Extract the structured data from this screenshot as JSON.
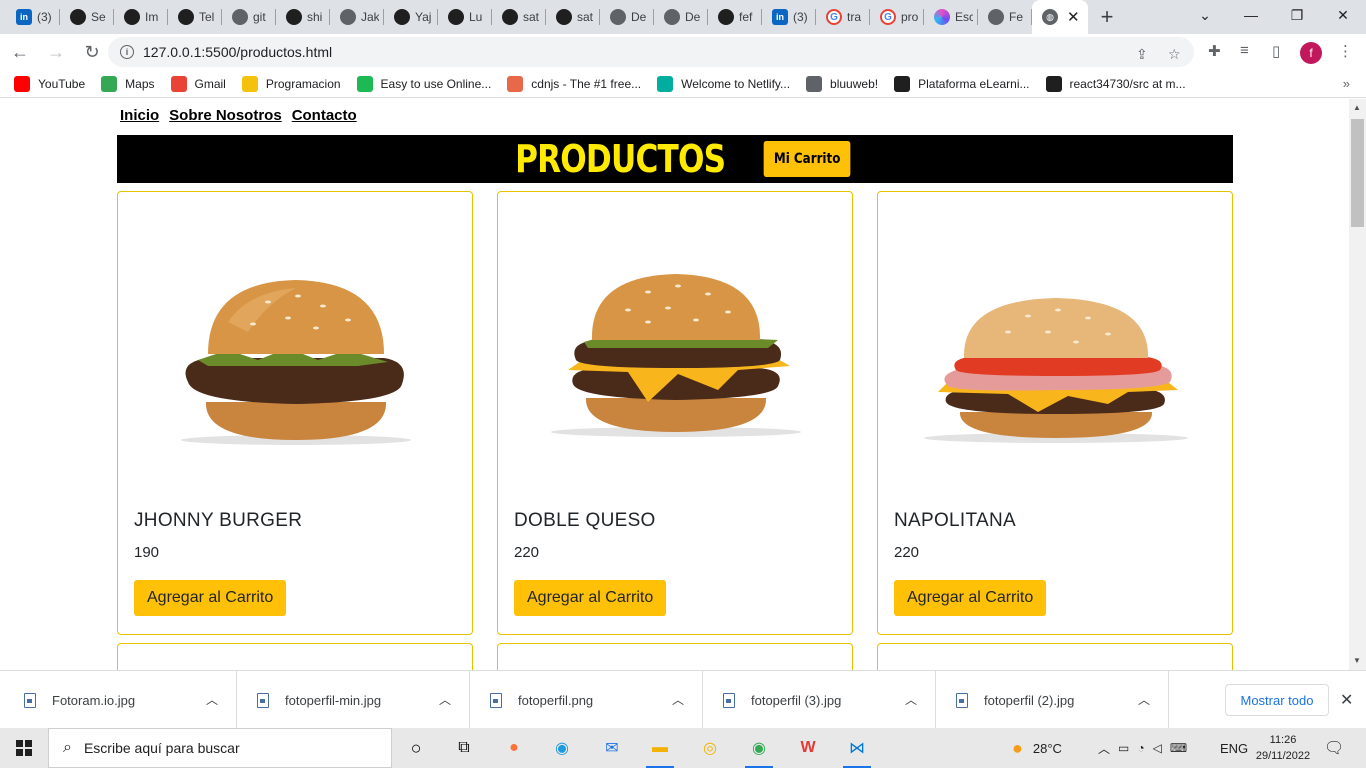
{
  "browser": {
    "tabs": [
      {
        "icon": "linkedin-icon",
        "label": "(3)"
      },
      {
        "icon": "github-icon",
        "label": "Se"
      },
      {
        "icon": "github-icon",
        "label": "Im"
      },
      {
        "icon": "github-icon",
        "label": "Tel"
      },
      {
        "icon": "globe-icon",
        "label": "git"
      },
      {
        "icon": "github-icon",
        "label": "shi"
      },
      {
        "icon": "globe-icon",
        "label": "Jak"
      },
      {
        "icon": "github-icon",
        "label": "Yaj"
      },
      {
        "icon": "github-icon",
        "label": "Lu"
      },
      {
        "icon": "github-icon",
        "label": "sat"
      },
      {
        "icon": "github-icon",
        "label": "sat"
      },
      {
        "icon": "globe-icon",
        "label": "De"
      },
      {
        "icon": "globe-icon",
        "label": "De"
      },
      {
        "icon": "github-icon",
        "label": "fef"
      },
      {
        "icon": "linkedin-icon",
        "label": "(3)"
      },
      {
        "icon": "google-icon",
        "label": "tra"
      },
      {
        "icon": "google-icon",
        "label": "pro"
      },
      {
        "icon": "ring-icon",
        "label": "Esc"
      },
      {
        "icon": "globe-icon",
        "label": "Fe"
      }
    ],
    "url": "127.0.0.1:5500/productos.html",
    "profile_initial": "f",
    "bookmarks": [
      {
        "label": "YouTube",
        "color": "#ff0000"
      },
      {
        "label": "Maps",
        "color": "#34a853"
      },
      {
        "label": "Gmail",
        "color": "#ea4335"
      },
      {
        "label": "Programacion",
        "color": "#f4c20d"
      },
      {
        "label": "Easy to use Online...",
        "color": "#1db954"
      },
      {
        "label": "cdnjs - The #1 free...",
        "color": "#e8684a"
      },
      {
        "label": "Welcome to Netlify...",
        "color": "#00ad9f"
      },
      {
        "label": "bluuweb!",
        "color": "#5f6368"
      },
      {
        "label": "Plataforma eLearni...",
        "color": "#1f1f1f"
      },
      {
        "label": "react34730/src at m...",
        "color": "#1f1f1f"
      }
    ]
  },
  "site": {
    "nav": [
      "Inicio",
      "Sobre Nosotros",
      "Contacto"
    ],
    "banner_title": "PRODUCTOS",
    "cart_button": "Mi Carrito",
    "products": [
      {
        "name": "JHONNY BURGER",
        "price": "190",
        "button": "Agregar al Carrito"
      },
      {
        "name": "DOBLE QUESO",
        "price": "220",
        "button": "Agregar al Carrito"
      },
      {
        "name": "NAPOLITANA",
        "price": "220",
        "button": "Agregar al Carrito"
      }
    ]
  },
  "downloads": {
    "files": [
      "Fotoram.io.jpg",
      "fotoperfil-min.jpg",
      "fotoperfil.png",
      "fotoperfil (3).jpg",
      "fotoperfil (2).jpg"
    ],
    "show_all": "Mostrar todo"
  },
  "taskbar": {
    "search_placeholder": "Escribe aquí para buscar",
    "weather": "28°C",
    "language": "ENG",
    "time": "11:26",
    "date": "29/11/2022"
  },
  "colors": {
    "accent_yellow": "#ffc107",
    "banner_title": "#ffea00",
    "card_border": "#e6c200"
  }
}
